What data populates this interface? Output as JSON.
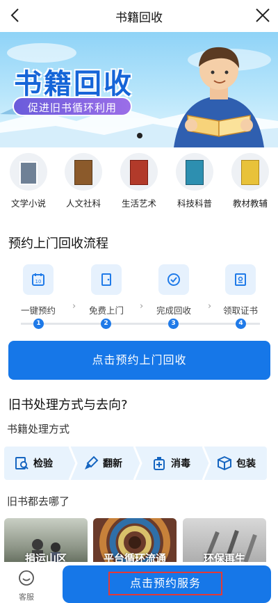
{
  "nav": {
    "title": "书籍回收"
  },
  "banner": {
    "title": "书籍回收",
    "subtitle": "促进旧书循环利用"
  },
  "categories": [
    {
      "label": "文学小说",
      "color": "#7a8a9a"
    },
    {
      "label": "人文社科",
      "color": "#8b5a2b"
    },
    {
      "label": "生活艺术",
      "color": "#b23a2a"
    },
    {
      "label": "科技科普",
      "color": "#2d8fb0"
    },
    {
      "label": "教材教辅",
      "color": "#e8c23a"
    }
  ],
  "flow": {
    "title": "预约上门回收流程",
    "steps": [
      {
        "label": "一键预约",
        "num": "1",
        "icon": "calendar-icon"
      },
      {
        "label": "免费上门",
        "num": "2",
        "icon": "door-icon"
      },
      {
        "label": "完成回收",
        "num": "3",
        "icon": "check-circle-icon"
      },
      {
        "label": "领取证书",
        "num": "4",
        "icon": "certificate-icon"
      }
    ],
    "button": "点击预约上门回收"
  },
  "disposal": {
    "title": "旧书处理方式与去向?",
    "method_title": "书籍处理方式",
    "methods": [
      {
        "label": "检验",
        "icon": "inspect-icon"
      },
      {
        "label": "翻新",
        "icon": "brush-icon"
      },
      {
        "label": "消毒",
        "icon": "disinfect-icon"
      },
      {
        "label": "包装",
        "icon": "package-icon"
      }
    ],
    "dest_title": "旧书都去哪了",
    "destinations": [
      {
        "label": "捐运山区"
      },
      {
        "label": "平台循环流通"
      },
      {
        "label": "环保再生"
      }
    ]
  },
  "bottom": {
    "service_label": "客服",
    "reserve_button": "点击预约服务"
  },
  "colors": {
    "primary": "#1677e8",
    "highlight_border": "#e53935"
  }
}
